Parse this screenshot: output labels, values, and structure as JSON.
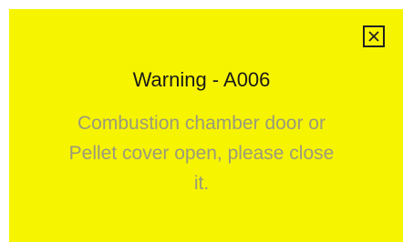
{
  "dialog": {
    "title": "Warning - A006",
    "message_lines": [
      "Combustion chamber door or",
      "Pellet cover open, please close",
      "it."
    ],
    "close_icon": "close-icon"
  },
  "colors": {
    "background": "#f7f400",
    "title_text": "#1a1a1a",
    "message_text": "#9a9a7c",
    "close_icon": "#222222"
  }
}
